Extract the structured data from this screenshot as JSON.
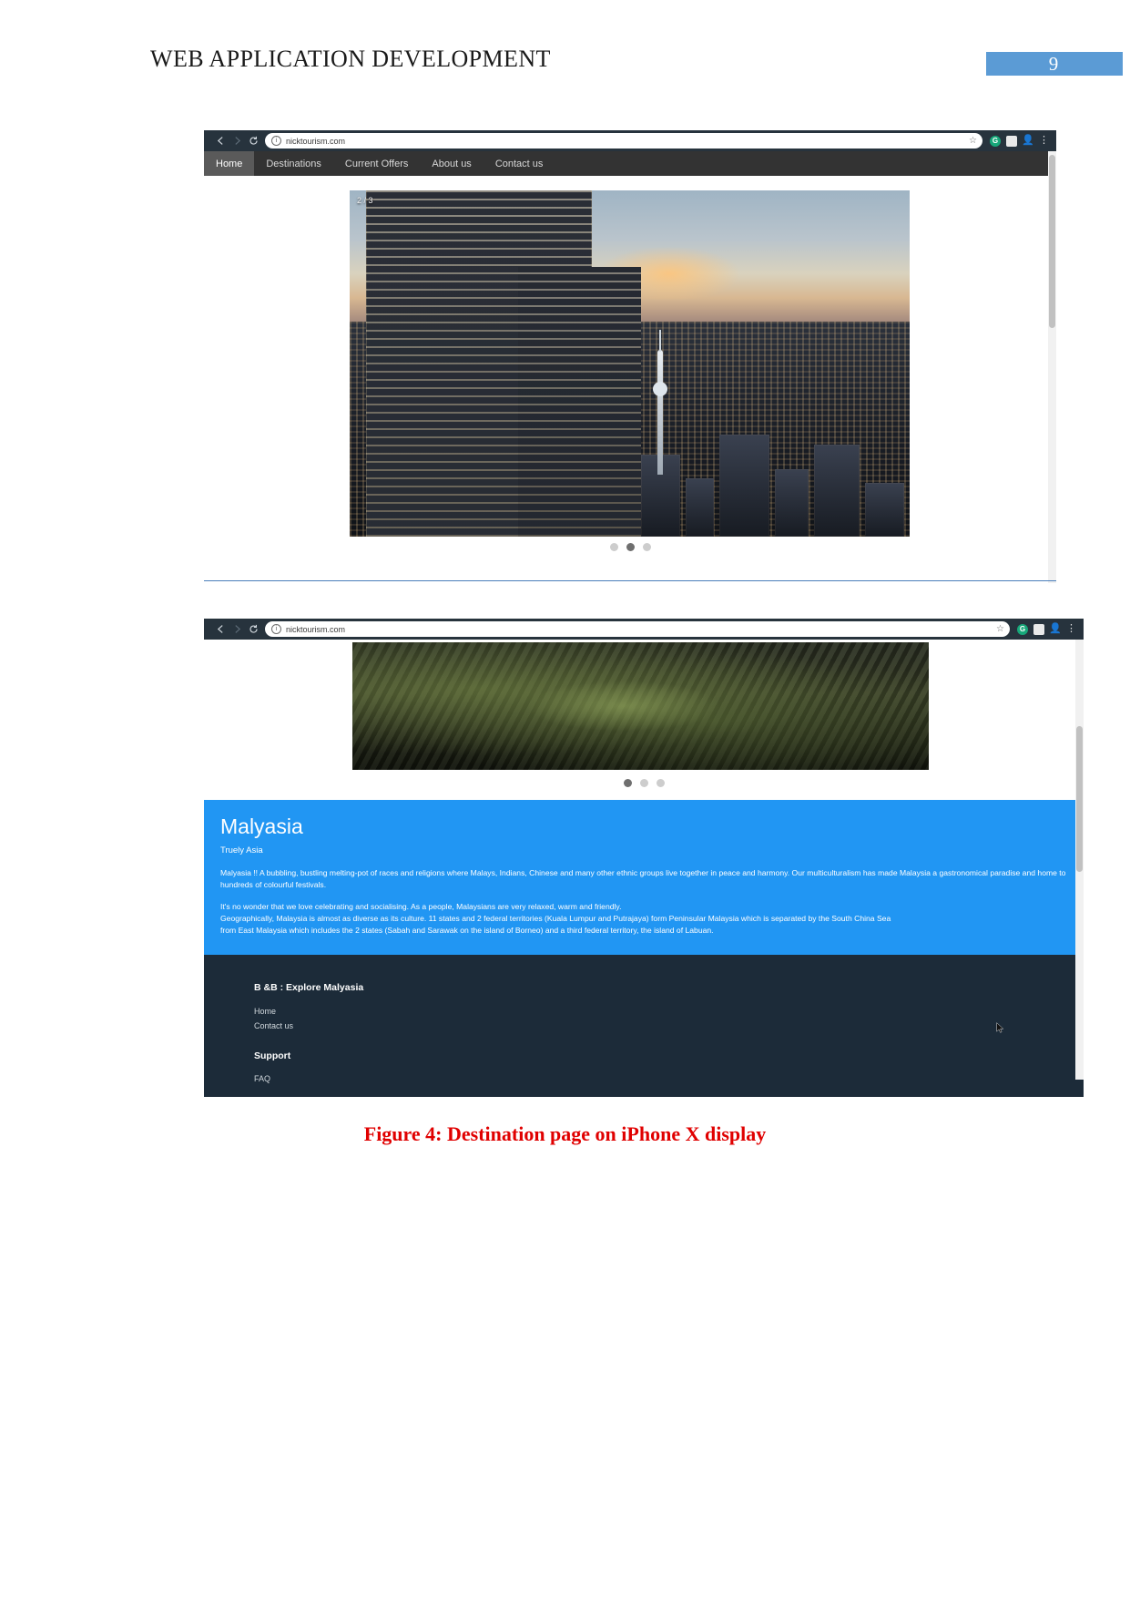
{
  "document": {
    "header_title": "WEB APPLICATION DEVELOPMENT",
    "page_number": "9",
    "header_accent_color": "#5b9bd5",
    "caption": "Figure 4:  Destination page on iPhone X display",
    "caption_color": "#e00000"
  },
  "browser_one": {
    "back_icon": "back-arrow-icon",
    "forward_icon": "forward-arrow-icon",
    "reload_icon": "reload-icon",
    "site_info_icon": "info-icon",
    "url": "nicktourism.com",
    "bookmark_icon": "star-icon",
    "extensions": [
      {
        "name": "grammarly-icon",
        "label": "G"
      },
      {
        "name": "extension-box-icon",
        "label": ""
      },
      {
        "name": "profile-icon",
        "label": ""
      }
    ],
    "menu_icon": "three-dot-menu-icon",
    "nav": [
      {
        "label": "Home",
        "active": true
      },
      {
        "label": "Destinations",
        "active": false
      },
      {
        "label": "Current Offers",
        "active": false
      },
      {
        "label": "About us",
        "active": false
      },
      {
        "label": "Contact us",
        "active": false
      }
    ],
    "slide_counter": "2 / 3",
    "slide_image_alt": "petronas-towers-kuala-lumpur-skyline-at-dusk",
    "dots": [
      false,
      true,
      false
    ]
  },
  "browser_two": {
    "back_icon": "back-arrow-icon",
    "forward_icon": "forward-arrow-icon",
    "reload_icon": "reload-icon",
    "site_info_icon": "info-icon",
    "url": "nicktourism.com",
    "bookmark_icon": "star-icon",
    "extensions": [
      {
        "name": "grammarly-icon",
        "label": "G"
      },
      {
        "name": "extension-box-icon",
        "label": ""
      },
      {
        "name": "profile-icon",
        "label": ""
      }
    ],
    "menu_icon": "three-dot-menu-icon",
    "slide_image_alt": "aerial-view-of-green-jungle-cliffs",
    "dots": [
      true,
      false,
      false
    ],
    "panel": {
      "title": "Malyasia",
      "subtitle": "Truely Asia",
      "paragraph_1": "Malyasia !! A bubbling, bustling melting-pot of races and religions where Malays, Indians, Chinese and many other ethnic groups live together in peace and harmony. Our multiculturalism has made Malaysia a gastronomical paradise and home to hundreds of colourful festivals.",
      "paragraph_2_line_1": "It's no wonder that we love celebrating and socialising. As a people, Malaysians are very relaxed, warm and friendly.",
      "paragraph_2_line_2": "Geographically, Malaysia is almost as diverse as its culture. 11 states and 2 federal territories (Kuala Lumpur and Putrajaya) form Peninsular Malaysia which is separated by the South China Sea",
      "paragraph_2_line_3": "from East Malaysia which includes the 2 states (Sabah and Sarawak on the island of Borneo) and a third federal territory, the island of Labuan.",
      "background_color": "#2196f3"
    },
    "footer": {
      "heading": "B &B : Explore Malyasia",
      "links": [
        "Home",
        "Contact us"
      ],
      "support_heading": "Support",
      "support_links": [
        "FAQ"
      ],
      "background_color": "#1c2b39",
      "cursor_icon": "mouse-pointer-icon"
    }
  }
}
